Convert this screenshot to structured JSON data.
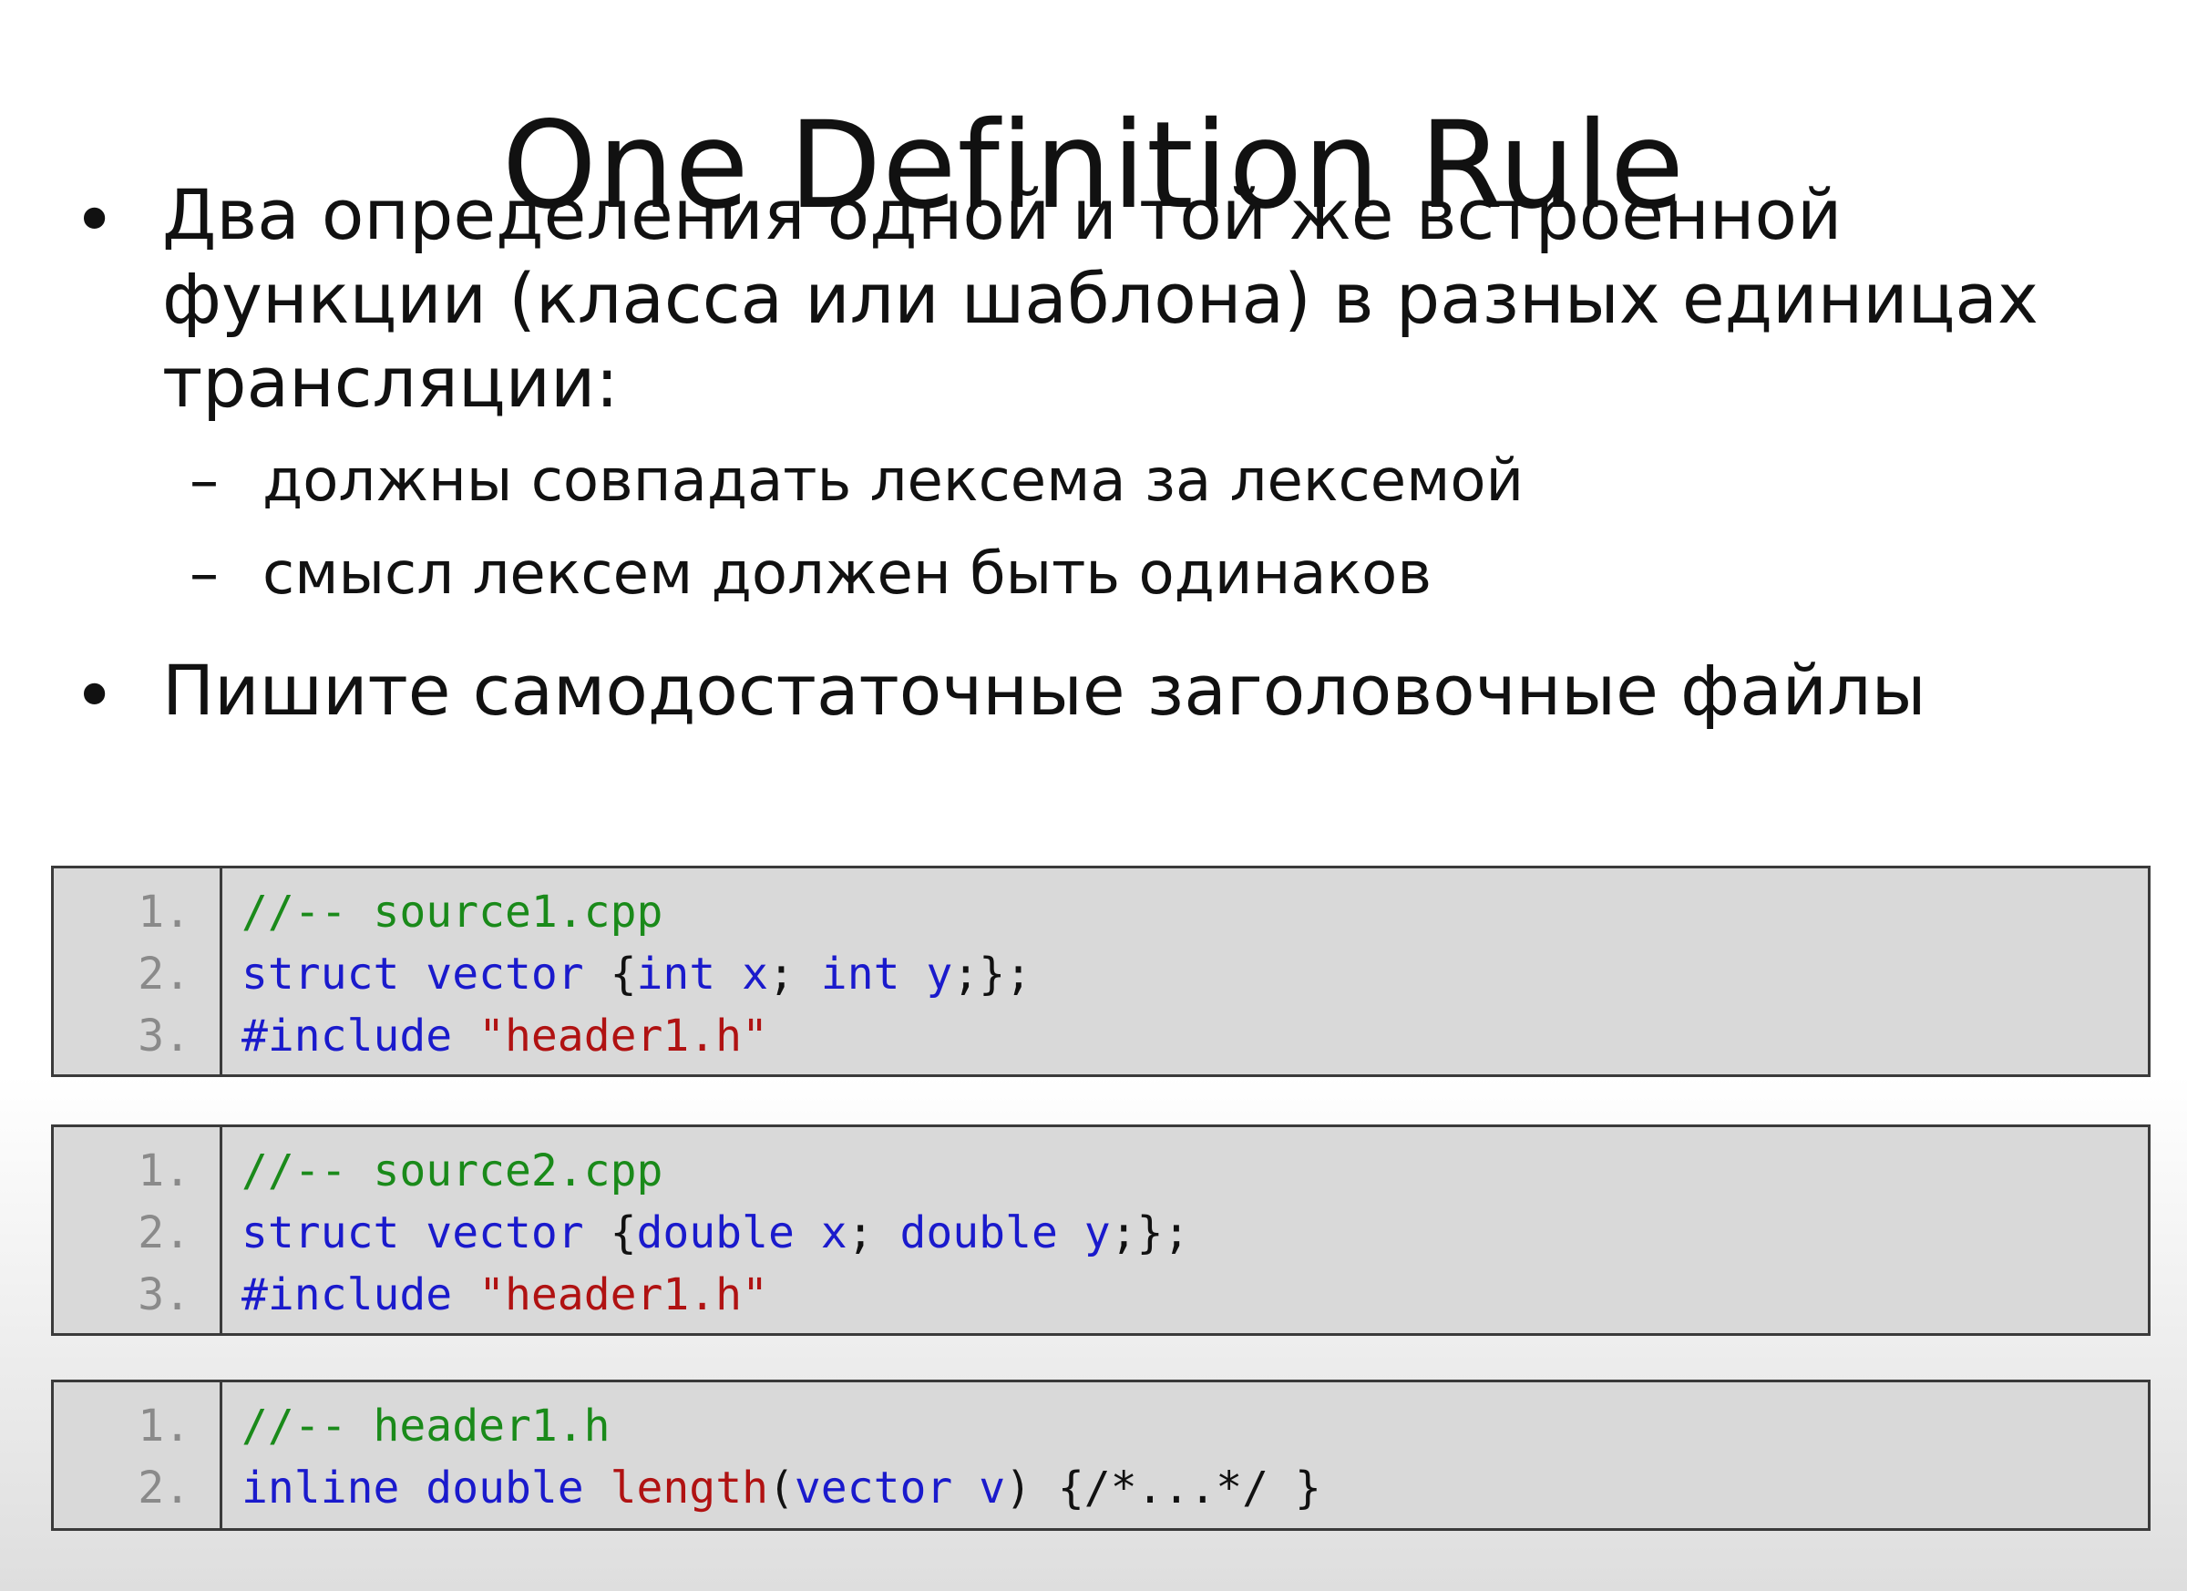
{
  "title": "One Definition Rule",
  "bullets": {
    "bullet_symbol": "•",
    "dash_symbol": "–",
    "first_lines": [
      "Два определения одной и той же встроенной",
      "функции (класса или шаблона) в разных единицах",
      "трансляции:"
    ],
    "sub_items": [
      "должны совпадать лексема за лексемой",
      "смысл лексем должен быть одинаков"
    ],
    "second": "Пишите самодостаточные заголовочные файлы"
  },
  "code_blocks": [
    {
      "lines": [
        {
          "number": "1.",
          "tokens": [
            {
              "text": "//-- source1.cpp",
              "kind": "comment"
            }
          ]
        },
        {
          "number": "2.",
          "tokens": [
            {
              "text": "struct",
              "kind": "keyword"
            },
            {
              "text": " ",
              "kind": "punct"
            },
            {
              "text": "vector",
              "kind": "keyword"
            },
            {
              "text": " {",
              "kind": "punct"
            },
            {
              "text": "int",
              "kind": "keyword"
            },
            {
              "text": " ",
              "kind": "punct"
            },
            {
              "text": "x",
              "kind": "var"
            },
            {
              "text": "; ",
              "kind": "punct"
            },
            {
              "text": "int",
              "kind": "keyword"
            },
            {
              "text": " ",
              "kind": "punct"
            },
            {
              "text": "y",
              "kind": "var"
            },
            {
              "text": ";};",
              "kind": "punct"
            }
          ]
        },
        {
          "number": "3.",
          "tokens": [
            {
              "text": "#include",
              "kind": "keyword"
            },
            {
              "text": " ",
              "kind": "punct"
            },
            {
              "text": "\"header1.h\"",
              "kind": "string"
            }
          ]
        }
      ]
    },
    {
      "lines": [
        {
          "number": "1.",
          "tokens": [
            {
              "text": "//-- source2.cpp",
              "kind": "comment"
            }
          ]
        },
        {
          "number": "2.",
          "tokens": [
            {
              "text": "struct",
              "kind": "keyword"
            },
            {
              "text": " ",
              "kind": "punct"
            },
            {
              "text": "vector",
              "kind": "keyword"
            },
            {
              "text": " {",
              "kind": "punct"
            },
            {
              "text": "double",
              "kind": "keyword"
            },
            {
              "text": " ",
              "kind": "punct"
            },
            {
              "text": "x",
              "kind": "var"
            },
            {
              "text": "; ",
              "kind": "punct"
            },
            {
              "text": "double",
              "kind": "keyword"
            },
            {
              "text": " ",
              "kind": "punct"
            },
            {
              "text": "y",
              "kind": "var"
            },
            {
              "text": ";};",
              "kind": "punct"
            }
          ]
        },
        {
          "number": "3.",
          "tokens": [
            {
              "text": "#include",
              "kind": "keyword"
            },
            {
              "text": " ",
              "kind": "punct"
            },
            {
              "text": "\"header1.h\"",
              "kind": "string"
            }
          ]
        }
      ]
    },
    {
      "lines": [
        {
          "number": "1.",
          "tokens": [
            {
              "text": "//-- header1.h",
              "kind": "comment"
            }
          ]
        },
        {
          "number": "2.",
          "tokens": [
            {
              "text": "inline",
              "kind": "keyword"
            },
            {
              "text": " ",
              "kind": "punct"
            },
            {
              "text": "double",
              "kind": "keyword"
            },
            {
              "text": " ",
              "kind": "punct"
            },
            {
              "text": "length",
              "kind": "func"
            },
            {
              "text": "(",
              "kind": "punct"
            },
            {
              "text": "vector",
              "kind": "keyword"
            },
            {
              "text": " ",
              "kind": "punct"
            },
            {
              "text": "v",
              "kind": "var"
            },
            {
              "text": ") {/*...*/ }",
              "kind": "punct"
            }
          ]
        }
      ]
    }
  ],
  "colors": {
    "comment": "#1a8a1a",
    "keyword": "#1a1acc",
    "string": "#b01212",
    "line_number": "#8a8a8a",
    "panel_background": "#d9d9d9",
    "panel_border": "#3a3a3a"
  }
}
